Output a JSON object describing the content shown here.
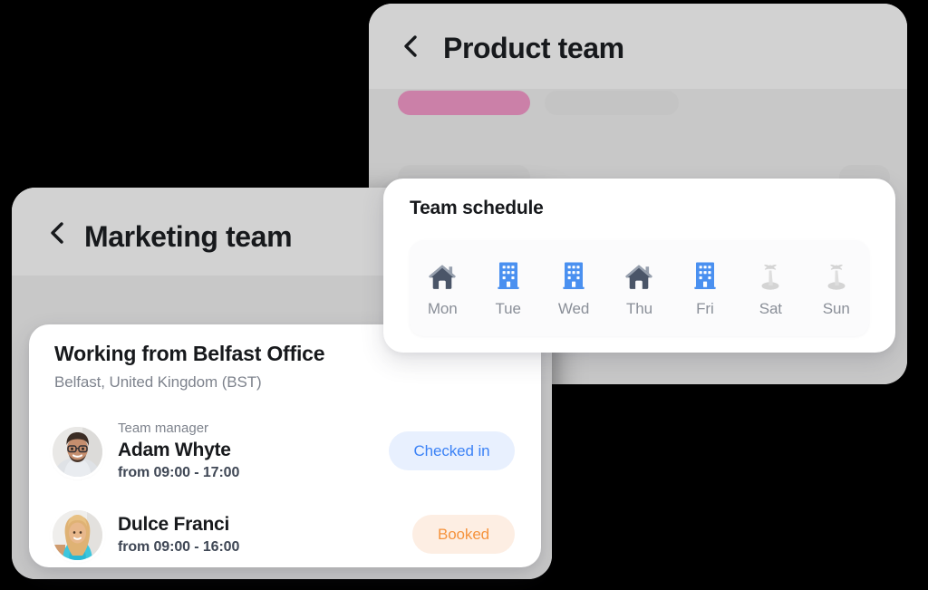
{
  "windows": {
    "product": {
      "title": "Product team",
      "back_icon": "chevron-left-icon",
      "tabs": [
        {
          "name": "tab-pill-active",
          "color": "#cb80a8"
        },
        {
          "name": "tab-pill-inactive",
          "color": "#c4c4c4"
        }
      ]
    },
    "marketing": {
      "title": "Marketing team",
      "back_icon": "chevron-left-icon"
    }
  },
  "team_schedule": {
    "title": "Team schedule",
    "days": [
      {
        "label": "Mon",
        "icon": "home-icon",
        "state": "home",
        "color": "#4a5568"
      },
      {
        "label": "Tue",
        "icon": "building-icon",
        "state": "office",
        "color": "#4a90f0"
      },
      {
        "label": "Wed",
        "icon": "building-icon",
        "state": "office",
        "color": "#4a90f0"
      },
      {
        "label": "Thu",
        "icon": "home-icon",
        "state": "home",
        "color": "#4a5568"
      },
      {
        "label": "Fri",
        "icon": "building-icon",
        "state": "office",
        "color": "#4a90f0"
      },
      {
        "label": "Sat",
        "icon": "palm-tree-icon",
        "state": "weekend",
        "color": "#d4d4d4"
      },
      {
        "label": "Sun",
        "icon": "palm-tree-icon",
        "state": "weekend",
        "color": "#d4d4d4"
      }
    ]
  },
  "office_card": {
    "title": "Working from Belfast Office",
    "subtitle": "Belfast, United Kingdom (BST)",
    "people": [
      {
        "role": "Team manager",
        "name": "Adam Whyte",
        "hours": "from 09:00 - 17:00",
        "status": "Checked in",
        "status_color": "#3b82f6",
        "status_bg": "#e8f0fe",
        "avatar": "avatar-adam-whyte"
      },
      {
        "role": "",
        "name": "Dulce Franci",
        "hours": "from 09:00 - 16:00",
        "status": "Booked",
        "status_color": "#f5933d",
        "status_bg": "#fdeee3",
        "avatar": "avatar-dulce-franci"
      }
    ]
  }
}
